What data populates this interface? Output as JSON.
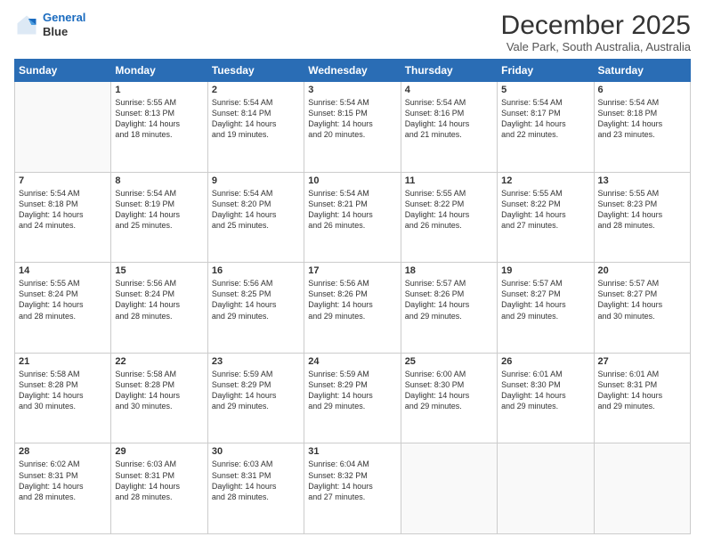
{
  "header": {
    "logo_line1": "General",
    "logo_line2": "Blue",
    "month": "December 2025",
    "location": "Vale Park, South Australia, Australia"
  },
  "days_of_week": [
    "Sunday",
    "Monday",
    "Tuesday",
    "Wednesday",
    "Thursday",
    "Friday",
    "Saturday"
  ],
  "weeks": [
    [
      {
        "day": "",
        "info": ""
      },
      {
        "day": "1",
        "info": "Sunrise: 5:55 AM\nSunset: 8:13 PM\nDaylight: 14 hours\nand 18 minutes."
      },
      {
        "day": "2",
        "info": "Sunrise: 5:54 AM\nSunset: 8:14 PM\nDaylight: 14 hours\nand 19 minutes."
      },
      {
        "day": "3",
        "info": "Sunrise: 5:54 AM\nSunset: 8:15 PM\nDaylight: 14 hours\nand 20 minutes."
      },
      {
        "day": "4",
        "info": "Sunrise: 5:54 AM\nSunset: 8:16 PM\nDaylight: 14 hours\nand 21 minutes."
      },
      {
        "day": "5",
        "info": "Sunrise: 5:54 AM\nSunset: 8:17 PM\nDaylight: 14 hours\nand 22 minutes."
      },
      {
        "day": "6",
        "info": "Sunrise: 5:54 AM\nSunset: 8:18 PM\nDaylight: 14 hours\nand 23 minutes."
      }
    ],
    [
      {
        "day": "7",
        "info": "Sunrise: 5:54 AM\nSunset: 8:18 PM\nDaylight: 14 hours\nand 24 minutes."
      },
      {
        "day": "8",
        "info": "Sunrise: 5:54 AM\nSunset: 8:19 PM\nDaylight: 14 hours\nand 25 minutes."
      },
      {
        "day": "9",
        "info": "Sunrise: 5:54 AM\nSunset: 8:20 PM\nDaylight: 14 hours\nand 25 minutes."
      },
      {
        "day": "10",
        "info": "Sunrise: 5:54 AM\nSunset: 8:21 PM\nDaylight: 14 hours\nand 26 minutes."
      },
      {
        "day": "11",
        "info": "Sunrise: 5:55 AM\nSunset: 8:22 PM\nDaylight: 14 hours\nand 26 minutes."
      },
      {
        "day": "12",
        "info": "Sunrise: 5:55 AM\nSunset: 8:22 PM\nDaylight: 14 hours\nand 27 minutes."
      },
      {
        "day": "13",
        "info": "Sunrise: 5:55 AM\nSunset: 8:23 PM\nDaylight: 14 hours\nand 28 minutes."
      }
    ],
    [
      {
        "day": "14",
        "info": "Sunrise: 5:55 AM\nSunset: 8:24 PM\nDaylight: 14 hours\nand 28 minutes."
      },
      {
        "day": "15",
        "info": "Sunrise: 5:56 AM\nSunset: 8:24 PM\nDaylight: 14 hours\nand 28 minutes."
      },
      {
        "day": "16",
        "info": "Sunrise: 5:56 AM\nSunset: 8:25 PM\nDaylight: 14 hours\nand 29 minutes."
      },
      {
        "day": "17",
        "info": "Sunrise: 5:56 AM\nSunset: 8:26 PM\nDaylight: 14 hours\nand 29 minutes."
      },
      {
        "day": "18",
        "info": "Sunrise: 5:57 AM\nSunset: 8:26 PM\nDaylight: 14 hours\nand 29 minutes."
      },
      {
        "day": "19",
        "info": "Sunrise: 5:57 AM\nSunset: 8:27 PM\nDaylight: 14 hours\nand 29 minutes."
      },
      {
        "day": "20",
        "info": "Sunrise: 5:57 AM\nSunset: 8:27 PM\nDaylight: 14 hours\nand 30 minutes."
      }
    ],
    [
      {
        "day": "21",
        "info": "Sunrise: 5:58 AM\nSunset: 8:28 PM\nDaylight: 14 hours\nand 30 minutes."
      },
      {
        "day": "22",
        "info": "Sunrise: 5:58 AM\nSunset: 8:28 PM\nDaylight: 14 hours\nand 30 minutes."
      },
      {
        "day": "23",
        "info": "Sunrise: 5:59 AM\nSunset: 8:29 PM\nDaylight: 14 hours\nand 29 minutes."
      },
      {
        "day": "24",
        "info": "Sunrise: 5:59 AM\nSunset: 8:29 PM\nDaylight: 14 hours\nand 29 minutes."
      },
      {
        "day": "25",
        "info": "Sunrise: 6:00 AM\nSunset: 8:30 PM\nDaylight: 14 hours\nand 29 minutes."
      },
      {
        "day": "26",
        "info": "Sunrise: 6:01 AM\nSunset: 8:30 PM\nDaylight: 14 hours\nand 29 minutes."
      },
      {
        "day": "27",
        "info": "Sunrise: 6:01 AM\nSunset: 8:31 PM\nDaylight: 14 hours\nand 29 minutes."
      }
    ],
    [
      {
        "day": "28",
        "info": "Sunrise: 6:02 AM\nSunset: 8:31 PM\nDaylight: 14 hours\nand 28 minutes."
      },
      {
        "day": "29",
        "info": "Sunrise: 6:03 AM\nSunset: 8:31 PM\nDaylight: 14 hours\nand 28 minutes."
      },
      {
        "day": "30",
        "info": "Sunrise: 6:03 AM\nSunset: 8:31 PM\nDaylight: 14 hours\nand 28 minutes."
      },
      {
        "day": "31",
        "info": "Sunrise: 6:04 AM\nSunset: 8:32 PM\nDaylight: 14 hours\nand 27 minutes."
      },
      {
        "day": "",
        "info": ""
      },
      {
        "day": "",
        "info": ""
      },
      {
        "day": "",
        "info": ""
      }
    ]
  ]
}
